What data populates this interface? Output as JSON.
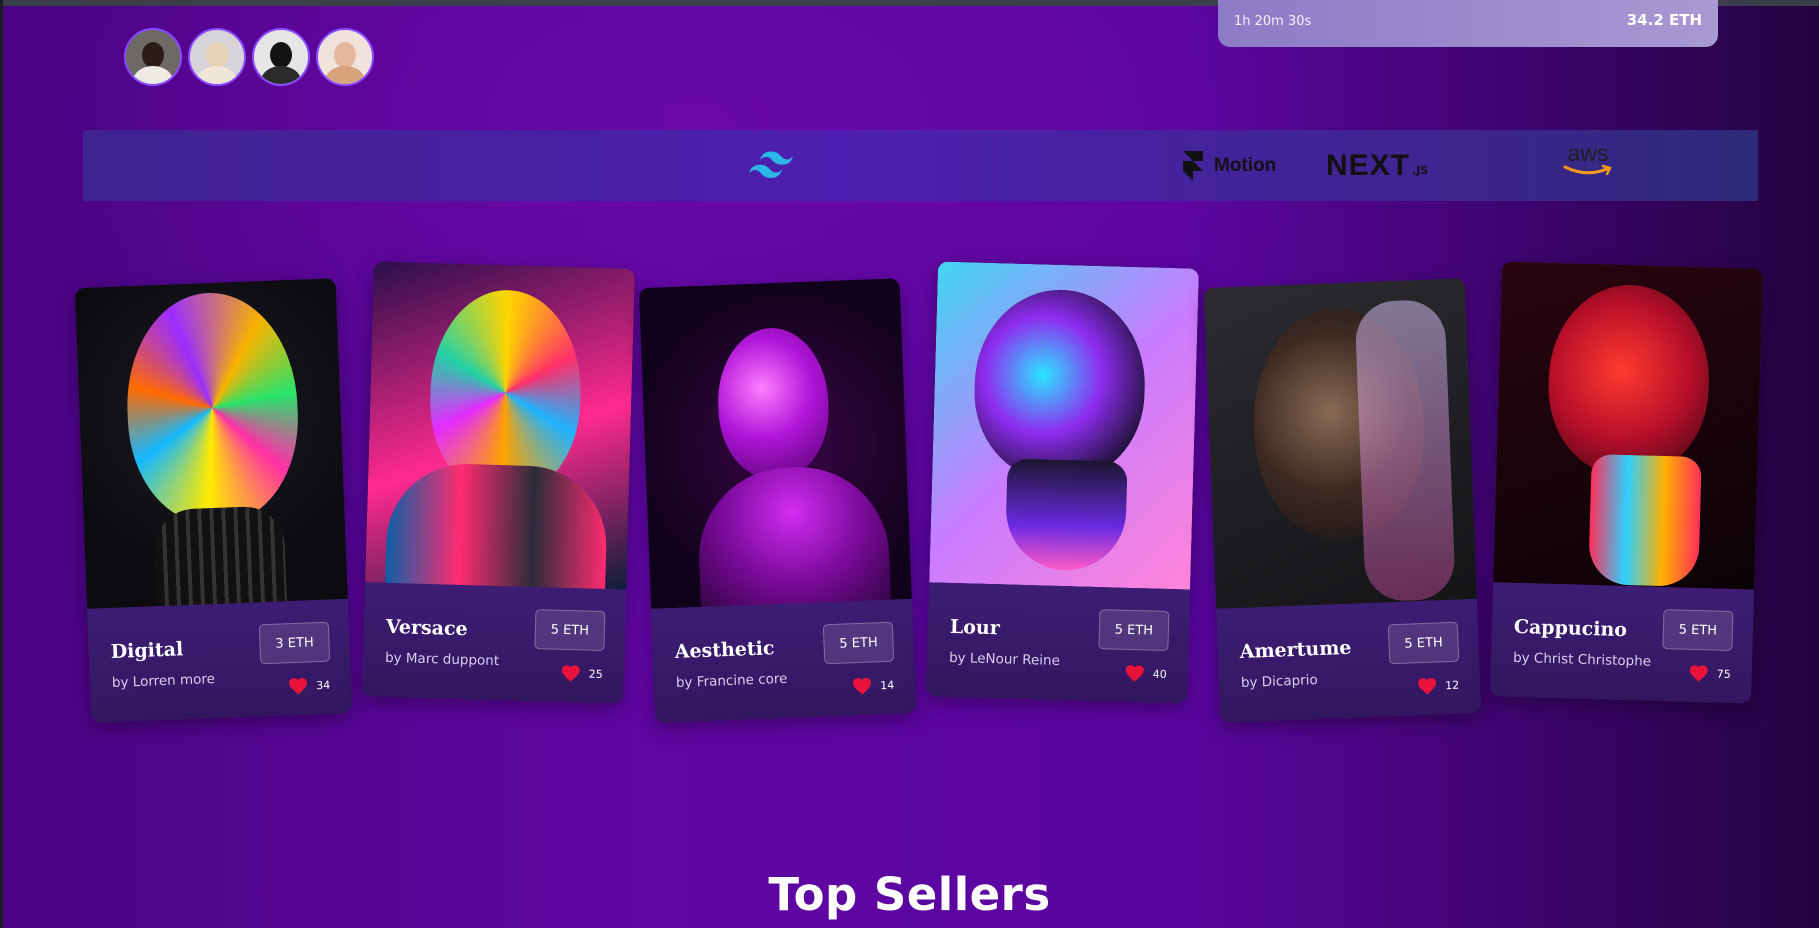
{
  "auction": {
    "time_left": "1h 20m 30s",
    "price": "34.2 ETH"
  },
  "avatars": [
    {
      "alt": "avatar 1"
    },
    {
      "alt": "avatar 2"
    },
    {
      "alt": "avatar 3"
    },
    {
      "alt": "avatar 4"
    }
  ],
  "brands": {
    "tailwind_icon": "tailwind-icon",
    "framer_label": "Motion",
    "next_label": "NEXT",
    "next_suffix": ".JS",
    "aws_label": "aws"
  },
  "cards": [
    {
      "title": "Digital",
      "author": "by Lorren more",
      "price": "3 ETH",
      "likes": "34"
    },
    {
      "title": "Versace",
      "author": "by Marc duppont",
      "price": "5 ETH",
      "likes": "25"
    },
    {
      "title": "Aesthetic",
      "author": "by Francine core",
      "price": "5 ETH",
      "likes": "14"
    },
    {
      "title": "Lour",
      "author": "by LeNour Reine",
      "price": "5 ETH",
      "likes": "40"
    },
    {
      "title": "Amertume",
      "author": "by Dicaprio",
      "price": "5 ETH",
      "likes": "12"
    },
    {
      "title": "Cappucino",
      "author": "by Christ Christophe",
      "price": "5 ETH",
      "likes": "75"
    }
  ],
  "section": {
    "title": "Top Sellers"
  },
  "colors": {
    "accent": "#8a4bff",
    "heart": "#e8123a",
    "card_info_bg": "#3d1d74"
  }
}
